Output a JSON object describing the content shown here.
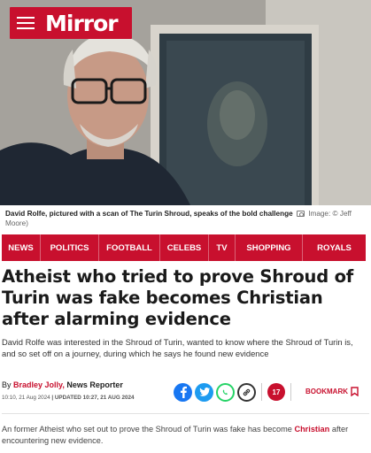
{
  "masthead": {
    "logo_text": "Mirror",
    "brand_color": "#c8102e",
    "menu_icon": "hamburger-icon"
  },
  "hero": {
    "caption_bold": "David Rolfe, pictured with a scan of The Turin Shroud, speaks of the bold challenge",
    "caption_credit": "Image: © Jeff Moore)"
  },
  "nav": {
    "items": [
      "NEWS",
      "POLITICS",
      "FOOTBALL",
      "CELEBS",
      "TV",
      "SHOPPING",
      "ROYALS"
    ]
  },
  "article": {
    "headline": "Atheist who tried to prove Shroud of Turin was fake becomes Christian after alarming evidence",
    "standfirst": "David Rolfe was interested in the Shroud of Turin, wanted to know where the Shroud of Turin is, and so set off on a journey, during which he says he found new evidence",
    "byline_prefix": "By",
    "author": "Bradley Jolly,",
    "role": "News Reporter",
    "published": "10:10, 21 Aug 2024",
    "updated": "| UPDATED 10:27, 21 AUG 2024",
    "comment_count": "17",
    "bookmark_label": "BOOKMARK",
    "body_start": "An former Atheist who set out to prove the Shroud of Turin was fake has become",
    "body_link": "Christian",
    "body_end": "after encountering new evidence."
  },
  "share_icons": [
    "facebook-icon",
    "twitter-icon",
    "whatsapp-icon",
    "link-icon"
  ]
}
